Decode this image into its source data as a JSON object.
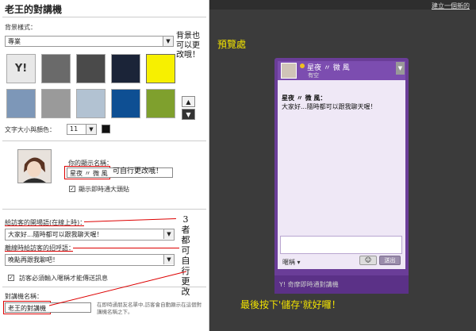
{
  "app": {
    "title": "老王的對講機"
  },
  "bg_style": {
    "label": "背景樣式：",
    "selected": "專業",
    "note": "背景也可以更改哦！"
  },
  "theme_tiles": [
    {
      "color": "#e8e8e8",
      "glyph": "Y!"
    },
    {
      "color": "#6a6a6a",
      "glyph": ""
    },
    {
      "color": "#4a4a4a",
      "glyph": ""
    },
    {
      "color": "#1b2438",
      "glyph": ""
    },
    {
      "color": "#f7f000",
      "glyph": ""
    },
    {
      "color": "#7d97b8",
      "glyph": ""
    },
    {
      "color": "#9a9a9a",
      "glyph": ""
    },
    {
      "color": "#b2c2d2",
      "glyph": ""
    },
    {
      "color": "#0e4f93",
      "glyph": ""
    },
    {
      "color": "#7fa02d",
      "glyph": ""
    }
  ],
  "font": {
    "label": "文字大小與顏色：",
    "size": "11",
    "color": "#111111"
  },
  "display_name": {
    "label": "你的顯示名稱：",
    "value": "星夜 〃 微 風",
    "note": "可自行更改哦！",
    "checkbox_label": "顯示即時通大頭貼"
  },
  "greeting": {
    "label": "給訪客的開場語(在線上時)：",
    "value": "大家好...隨時都可以跟我聊天喔！"
  },
  "farewell": {
    "label": "離線時給訪客的招呼語：",
    "value": "晚點再跟我聊吧！"
  },
  "side_note": "3者都可自行更改",
  "visitor_checkbox_label": "訪客必須輸入暱稱才能傳送訊息",
  "widget_name": {
    "label": "對講機名稱：",
    "value": "老王的對講機",
    "help": "在即時通朋友名單中,訪客會自動顯示在這個對講機名稱之下。"
  },
  "topbar": {
    "create_link": "建立一個新的"
  },
  "preview": {
    "label": "預覽處",
    "user_name": "星夜 〃 微 風",
    "status": "有空",
    "message_name": "星夜 〃 微 風：",
    "message_text": "大家好...隨時都可以跟我聊天喔！",
    "nickname_label": "暱稱",
    "send_label": "送出",
    "brand": "Y! 奇摩即時通對講機"
  },
  "bottom_note": "最後按下'儲存'就好囉！"
}
